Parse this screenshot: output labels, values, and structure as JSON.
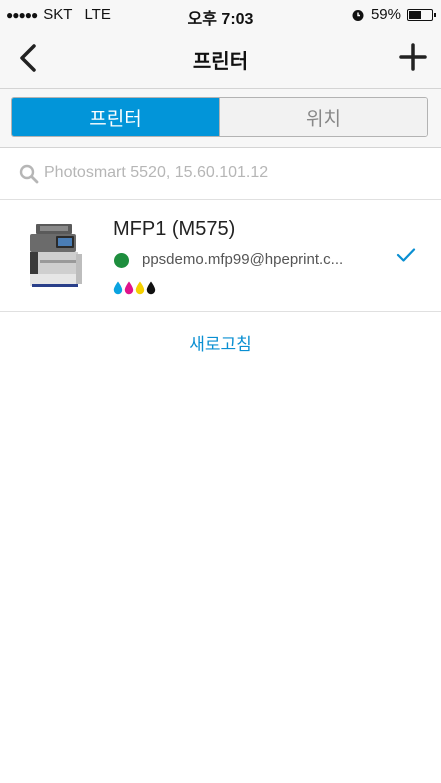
{
  "status_bar": {
    "carrier": "SKT",
    "network": "LTE",
    "time": "오후 7:03",
    "battery_percent": "59%",
    "battery_level": 0.59
  },
  "nav": {
    "title": "프린터",
    "back_icon": "chevron-left-icon",
    "add_icon": "plus-icon"
  },
  "segments": {
    "printers": "프린터",
    "location": "위치",
    "selected": "printers"
  },
  "search": {
    "placeholder": "Photosmart 5520, 15.60.101.12"
  },
  "printer": {
    "name": "MFP1 (M575)",
    "email": "ppsdemo.mfp99@hpeprint.c...",
    "status_color": "#1e8e3e",
    "ink_colors": [
      "#0aa3e0",
      "#e0138c",
      "#f5d000",
      "#111111"
    ],
    "selected": true
  },
  "refresh_label": "새로고침",
  "colors": {
    "accent": "#0295d9",
    "link": "#0a8fd2"
  }
}
